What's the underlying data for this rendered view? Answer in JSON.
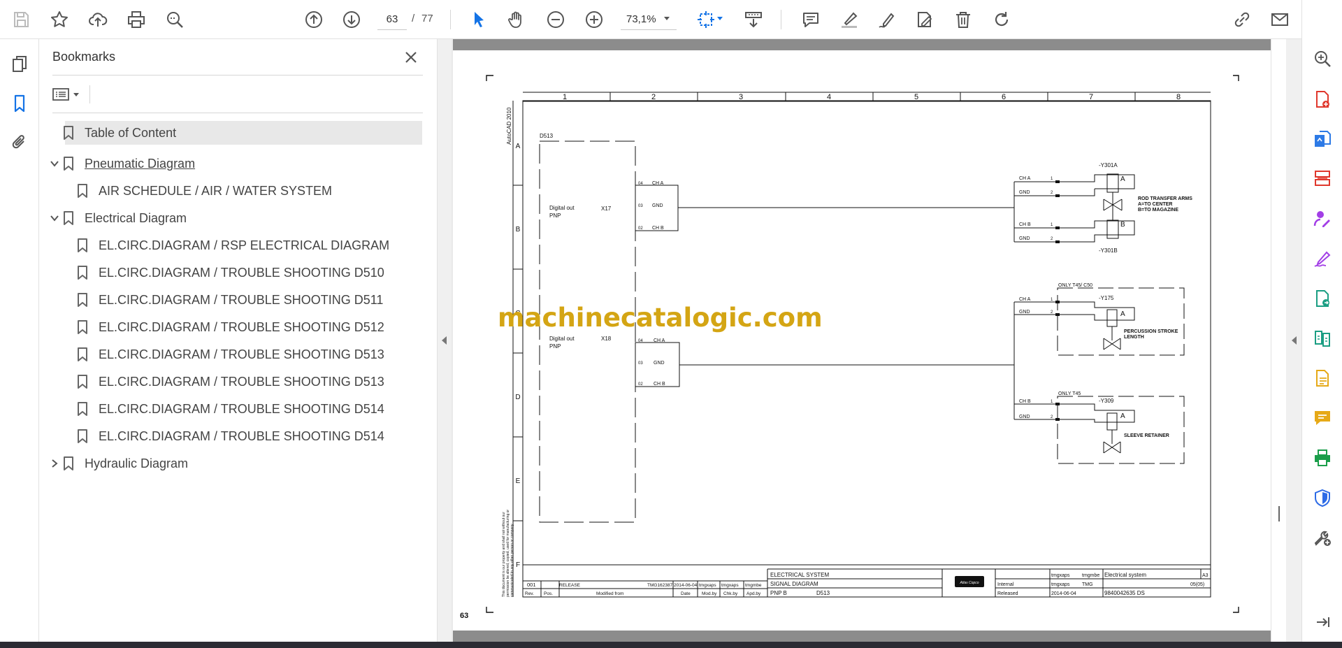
{
  "toolbar": {
    "current_page": "63",
    "page_separator": "/",
    "total_pages": "77",
    "zoom": "73,1%"
  },
  "bookmarks": {
    "title": "Bookmarks",
    "items": [
      {
        "label": "Table of Content",
        "level": 0,
        "selected": true
      },
      {
        "label": "Pneumatic Diagram",
        "level": 0,
        "expanded": true,
        "underlined": true
      },
      {
        "label": "AIR SCHEDULE / AIR / WATER SYSTEM",
        "level": 1
      },
      {
        "label": "Electrical Diagram",
        "level": 0,
        "expanded": true
      },
      {
        "label": "EL.CIRC.DIAGRAM / RSP ELECTRICAL DIAGRAM",
        "level": 1
      },
      {
        "label": "EL.CIRC.DIAGRAM / TROUBLE SHOOTING D510",
        "level": 1
      },
      {
        "label": "EL.CIRC.DIAGRAM / TROUBLE SHOOTING D511",
        "level": 1
      },
      {
        "label": "EL.CIRC.DIAGRAM / TROUBLE SHOOTING D512",
        "level": 1
      },
      {
        "label": "EL.CIRC.DIAGRAM / TROUBLE SHOOTING D513",
        "level": 1
      },
      {
        "label": "EL.CIRC.DIAGRAM / TROUBLE SHOOTING D513",
        "level": 1
      },
      {
        "label": "EL.CIRC.DIAGRAM / TROUBLE SHOOTING D514",
        "level": 1
      },
      {
        "label": "EL.CIRC.DIAGRAM / TROUBLE SHOOTING D514",
        "level": 1
      },
      {
        "label": "Hydraulic Diagram",
        "level": 0,
        "expanded": false
      }
    ]
  },
  "document": {
    "watermark": "machinecatalogic.com",
    "page_number": "63",
    "side_label": "AutoCAD 2010",
    "columns": [
      "1",
      "2",
      "3",
      "4",
      "5",
      "6",
      "7",
      "8"
    ],
    "rows": [
      "A",
      "B",
      "C",
      "D",
      "E",
      "F"
    ],
    "module": "D513",
    "block1": {
      "label": "Digital out",
      "label2": "PNP",
      "connector": "X17",
      "pins": [
        {
          "no": "04",
          "name": "CH A"
        },
        {
          "no": "03",
          "name": "GND"
        },
        {
          "no": "02",
          "name": "CH B"
        }
      ]
    },
    "block2": {
      "label": "Digital out",
      "label2": "PNP",
      "connector": "X18",
      "pins": [
        {
          "no": "04",
          "name": "CH A"
        },
        {
          "no": "03",
          "name": "GND"
        },
        {
          "no": "02",
          "name": "CH B"
        }
      ]
    },
    "valves": {
      "y301a": {
        "tag": "-Y301A",
        "letter": "A"
      },
      "y301b": {
        "tag": "-Y301B",
        "letter": "B"
      },
      "rod_transfer": [
        "ROD TRANSFER ARMS",
        "A=TO CENTER",
        "B=TO MAGAZINE"
      ],
      "y175": {
        "group": "ONLY T45/ C50",
        "tag": "-Y175",
        "letter": "A",
        "desc": [
          "PERCUSSION STROKE",
          "LENGTH"
        ]
      },
      "y309": {
        "group": "ONLY T45",
        "tag": "-Y309",
        "letter": "A",
        "desc": "SLEEVE RETAINER"
      }
    },
    "valve_pins": {
      "ch_a": "CH A",
      "ch_b": "CH B",
      "gnd": "GND",
      "p1": "1",
      "p2": "2"
    },
    "copyright": [
      "This document is our property and shall not without our",
      "permission be altered, copied, used for manufacturing or",
      "communicated to any other person or company."
    ],
    "title_block": {
      "rev": "001",
      "release": "RELEASE",
      "tmg": "TMG162387",
      "date": "2014-06-04",
      "user1": "tmgxaps",
      "user2": "tmgxaps",
      "user3": "tmgmbe",
      "h_rev": "Rev.",
      "h_pos": "Pos.",
      "h_modified": "Modified from",
      "h_date": "Date",
      "h_modby": "Mod.by",
      "h_chkby": "Chk.by",
      "h_apdby": "Apd.by",
      "title1": "ELECTRICAL SYSTEM",
      "title2": "SIGNAL DIAGRAM",
      "title3": "PNP B",
      "title3b": "D513",
      "logo": "Atlas Copco",
      "drawn": "tmgxaps",
      "approver": "tmgmbe",
      "class": "Electrical system",
      "size": "A3",
      "conf": "Internal",
      "resp": "tmgxaps",
      "center": "TMG",
      "sheet": "05(05)",
      "status": "Released",
      "date2": "2014-06-04",
      "docno": "9840042635 DS"
    }
  }
}
